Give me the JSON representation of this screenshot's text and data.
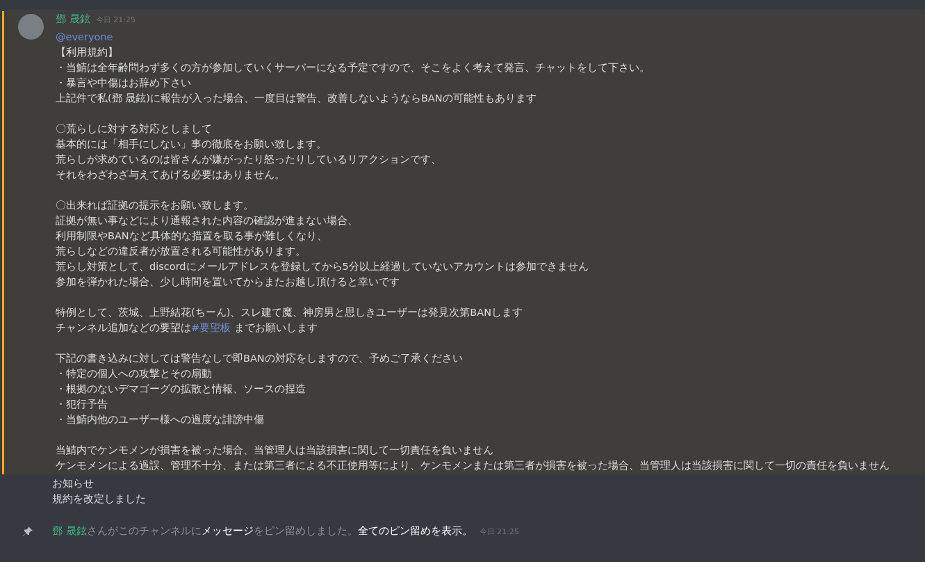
{
  "message": {
    "author": "鄧 晟鉉",
    "timestamp": "今日 21:25",
    "highlighted": true,
    "mention": "@everyone",
    "paragraphs": [
      [
        [
          {
            "kind": "plain",
            "text": "【利用規約】"
          }
        ],
        [
          {
            "kind": "plain",
            "text": "・当鯖は全年齢問わず多くの方が参加していくサーバーになる予定ですので、そこをよく考えて発言、チャットをして下さい。"
          }
        ],
        [
          {
            "kind": "plain",
            "text": "・暴言や中傷はお辞め下さい"
          }
        ],
        [
          {
            "kind": "plain",
            "text": "上記件で私(鄧 晟鉉)に報告が入った場合、一度目は警告、改善しないようならBANの可能性もあります"
          }
        ]
      ],
      [
        [
          {
            "kind": "plain",
            "text": "〇荒らしに対する対応としまして"
          }
        ],
        [
          {
            "kind": "plain",
            "text": "基本的には「相手にしない」事の徹底をお願い致します。"
          }
        ],
        [
          {
            "kind": "plain",
            "text": "荒らしが求めているのは皆さんが嫌がったり怒ったりしているリアクションです、"
          }
        ],
        [
          {
            "kind": "plain",
            "text": "それをわざわざ与えてあげる必要はありません。"
          }
        ]
      ],
      [
        [
          {
            "kind": "plain",
            "text": "〇出来れば証拠の提示をお願い致します。"
          }
        ],
        [
          {
            "kind": "plain",
            "text": "証拠が無い事などにより通報された内容の確認が進まない場合、"
          }
        ],
        [
          {
            "kind": "plain",
            "text": "利用制限やBANなど具体的な措置を取る事が難しくなり、"
          }
        ],
        [
          {
            "kind": "plain",
            "text": "荒らしなどの違反者が放置される可能性があります。"
          }
        ],
        [
          {
            "kind": "plain",
            "text": "荒らし対策として、discordにメールアドレスを登録してから5分以上経過していないアカウントは参加できません"
          }
        ],
        [
          {
            "kind": "plain",
            "text": "参加を弾かれた場合、少し時間を置いてからまたお越し頂けると幸いです"
          }
        ]
      ],
      [
        [
          {
            "kind": "plain",
            "text": "特例として、茨城、上野結花(ちーん)、スレ建て魔、神房男と思しきユーザーは発見次第BANします"
          }
        ],
        [
          {
            "kind": "plain",
            "text": "チャンネル追加などの要望は"
          },
          {
            "kind": "channel",
            "text": "#要望板"
          },
          {
            "kind": "plain",
            "text": " までお願いします"
          }
        ]
      ],
      [
        [
          {
            "kind": "plain",
            "text": "下記の書き込みに対しては警告なしで即BANの対応をしますので、予めご了承ください"
          }
        ],
        [
          {
            "kind": "plain",
            "text": "・特定の個人への攻撃とその扇動"
          }
        ],
        [
          {
            "kind": "plain",
            "text": "・根拠のないデマゴーグの拡散と情報、ソースの捏造"
          }
        ],
        [
          {
            "kind": "plain",
            "text": "・犯行予告"
          }
        ],
        [
          {
            "kind": "plain",
            "text": "・当鯖内他のユーザー様への過度な誹謗中傷"
          }
        ]
      ],
      [
        [
          {
            "kind": "plain",
            "text": "当鯖内でケンモメンが損害を被った場合、当管理人は当該損害に関して一切責任を負いません"
          }
        ],
        [
          {
            "kind": "plain",
            "text": "ケンモメンによる過誤、管理不十分、または第三者による不正使用等により、ケンモメンまたは第三者が損害を被った場合、当管理人は当該損害に関して一切の責任を負いません"
          }
        ]
      ]
    ]
  },
  "followups": [
    "お知らせ",
    "規約を改定しました"
  ],
  "system_message": {
    "parts": [
      {
        "kind": "user",
        "text": "鄧 晟鉉"
      },
      {
        "kind": "plain",
        "text": "さんがこのチャンネルに"
      },
      {
        "kind": "link",
        "text": "メッセージ"
      },
      {
        "kind": "plain",
        "text": "をピン留めしました。"
      },
      {
        "kind": "link",
        "text": "全てのピン留めを表示。"
      }
    ],
    "timestamp": "今日 21:25"
  }
}
